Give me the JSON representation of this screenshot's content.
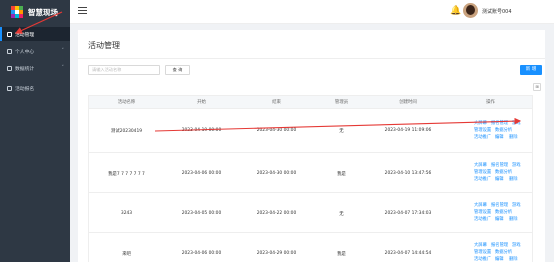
{
  "brand": {
    "name": "智慧现场"
  },
  "sidebar": {
    "items": [
      {
        "label": "活动管理",
        "active": true
      },
      {
        "label": "个人中心",
        "active": false,
        "caret": "˅"
      },
      {
        "label": "数据统计",
        "active": false,
        "caret": "˅"
      },
      {
        "label": "活动报名",
        "active": false
      }
    ]
  },
  "header": {
    "user_name": "测试账号004",
    "bell_icon": "🔔"
  },
  "main": {
    "title": "活动管理",
    "search_placeholder": "请输入活动名称",
    "search_label": "查 询",
    "add_label": "新 增",
    "tool_icon": "⊞"
  },
  "table": {
    "columns": [
      "活动名称",
      "开始",
      "结束",
      "管理员",
      "创建时间",
      "操作"
    ],
    "rows": [
      {
        "name": "测试20230419",
        "start": "2023-04-19 00:00",
        "end": "2023-04-30 00:00",
        "admin": "无",
        "created": "2023-04-19 11:09:06",
        "ops": [
          "大屏幕",
          "报名管理",
          "游戏",
          "管理设置",
          "数据分析",
          "活动推广",
          "编辑",
          "删除"
        ]
      },
      {
        "name": "我是7 7 7 7 7 7 7",
        "start": "2023-04-06 00:00",
        "end": "2023-04-30 00:00",
        "admin": "我是",
        "created": "2023-04-10 13:47:56",
        "ops": [
          "大屏幕",
          "报名管理",
          "游戏",
          "管理设置",
          "数据分析",
          "活动推广",
          "编辑",
          "删除"
        ]
      },
      {
        "name": "3243",
        "start": "2023-04-05 00:00",
        "end": "2023-04-22 00:00",
        "admin": "无",
        "created": "2023-04-07 17:34:03",
        "ops": [
          "大屏幕",
          "报名管理",
          "游戏",
          "管理设置",
          "数据分析",
          "活动推广",
          "编辑",
          "删除"
        ]
      },
      {
        "name": "来吧",
        "start": "2023-04-06 00:00",
        "end": "2023-04-29 00:00",
        "admin": "我是",
        "created": "2023-04-07 14:44:54",
        "ops": [
          "大屏幕",
          "报名管理",
          "游戏",
          "管理设置",
          "数据分析",
          "活动推广",
          "编辑",
          "删除"
        ]
      }
    ]
  },
  "colors": {
    "sidebar": "#2e3844",
    "accent": "#1890ff",
    "annotation": "#e53935"
  }
}
